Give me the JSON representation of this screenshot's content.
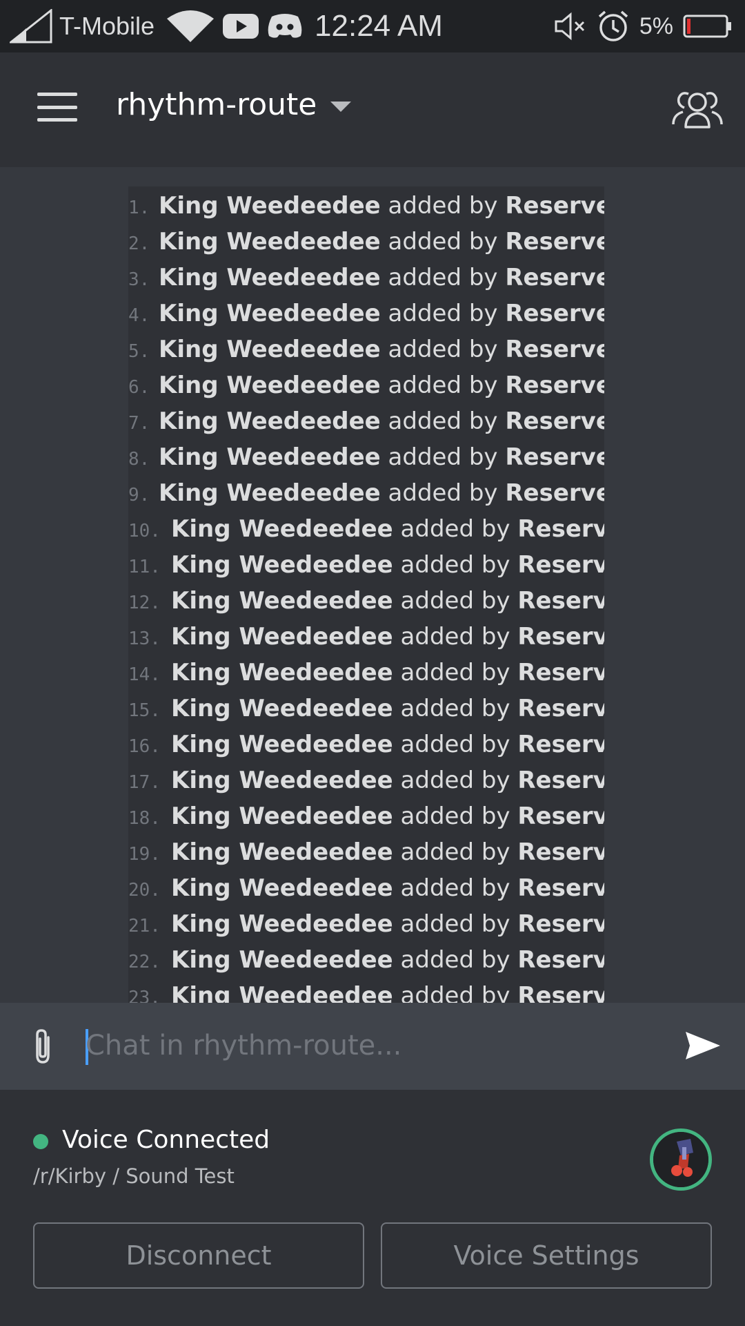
{
  "status_bar": {
    "carrier": "T-Mobile",
    "time": "12:24 AM",
    "battery_percent": "5%",
    "icons": [
      "signal-icon",
      "wifi-icon",
      "youtube-icon",
      "discord-icon",
      "mute-icon",
      "alarm-icon",
      "battery-icon"
    ],
    "battery_color": "#e03131"
  },
  "header": {
    "channel_name": "rhythm-route",
    "icons": [
      "menu-icon",
      "dropdown-caret-icon",
      "members-icon"
    ]
  },
  "queue": {
    "lines": [
      {
        "num": "1.",
        "name": "King Weedeedee",
        "mid": "added by",
        "by": "Reserved"
      },
      {
        "num": "2.",
        "name": "King Weedeedee",
        "mid": "added by",
        "by": "Reserved"
      },
      {
        "num": "3.",
        "name": "King Weedeedee",
        "mid": "added by",
        "by": "Reserved"
      },
      {
        "num": "4.",
        "name": "King Weedeedee",
        "mid": "added by",
        "by": "Reserved"
      },
      {
        "num": "5.",
        "name": "King Weedeedee",
        "mid": "added by",
        "by": "Reserved"
      },
      {
        "num": "6.",
        "name": "King Weedeedee",
        "mid": "added by",
        "by": "Reserved"
      },
      {
        "num": "7.",
        "name": "King Weedeedee",
        "mid": "added by",
        "by": "Reserved"
      },
      {
        "num": "8.",
        "name": "King Weedeedee",
        "mid": "added by",
        "by": "Reserved"
      },
      {
        "num": "9.",
        "name": "King Weedeedee",
        "mid": "added by",
        "by": "Reserved"
      },
      {
        "num": "10.",
        "name": "King Weedeedee",
        "mid": "added by",
        "by": "Reserved"
      },
      {
        "num": "11.",
        "name": "King Weedeedee",
        "mid": "added by",
        "by": "Reserved"
      },
      {
        "num": "12.",
        "name": "King Weedeedee",
        "mid": "added by",
        "by": "Reserved"
      },
      {
        "num": "13.",
        "name": "King Weedeedee",
        "mid": "added by",
        "by": "Reserved"
      },
      {
        "num": "14.",
        "name": "King Weedeedee",
        "mid": "added by",
        "by": "Reserved"
      },
      {
        "num": "15.",
        "name": "King Weedeedee",
        "mid": "added by",
        "by": "Reserved"
      },
      {
        "num": "16.",
        "name": "King Weedeedee",
        "mid": "added by",
        "by": "Reserved"
      },
      {
        "num": "17.",
        "name": "King Weedeedee",
        "mid": "added by",
        "by": "Reserved"
      },
      {
        "num": "18.",
        "name": "King Weedeedee",
        "mid": "added by",
        "by": "Reserved"
      },
      {
        "num": "19.",
        "name": "King Weedeedee",
        "mid": "added by",
        "by": "Reserved"
      },
      {
        "num": "20.",
        "name": "King Weedeedee",
        "mid": "added by",
        "by": "Reserved"
      },
      {
        "num": "21.",
        "name": "King Weedeedee",
        "mid": "added by",
        "by": "Reserved"
      },
      {
        "num": "22.",
        "name": "King Weedeedee",
        "mid": "added by",
        "by": "Reserved"
      },
      {
        "num": "23.",
        "name": "King Weedeedee",
        "mid": "added by",
        "by": "Reserved"
      }
    ]
  },
  "composer": {
    "placeholder": "Chat in rhythm-route...",
    "value": "",
    "icons": [
      "attach-icon",
      "send-icon"
    ]
  },
  "voice": {
    "status": "Voice Connected",
    "channel": "/r/Kirby / Sound Test",
    "status_color": "#43b581",
    "disconnect_label": "Disconnect",
    "settings_label": "Voice Settings"
  }
}
